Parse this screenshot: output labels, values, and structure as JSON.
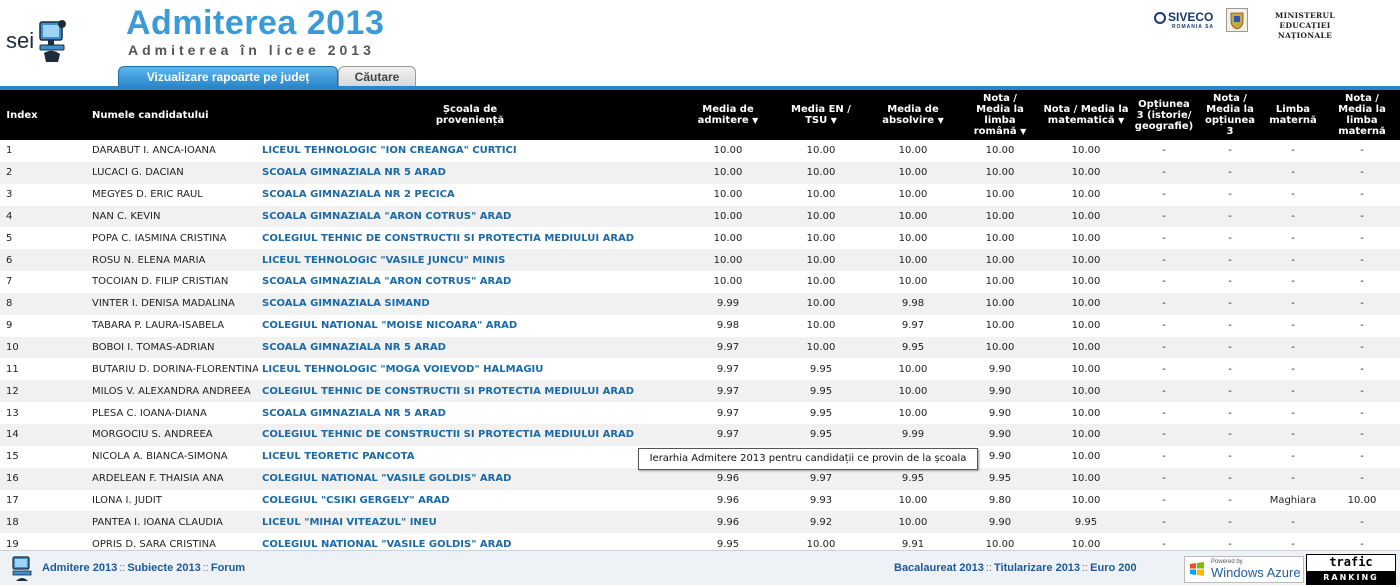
{
  "header": {
    "logo_text": "sei",
    "title": "Admiterea 2013",
    "subtitle": "Admiterea în licee 2013",
    "tabs": [
      {
        "label": "Vizualizare rapoarte pe județ",
        "active": true
      },
      {
        "label": "Căutare",
        "active": false
      }
    ],
    "partner_logo": "SIVECO",
    "partner_sub": "ROMANIA SA",
    "ministry": "MINISTERUL EDUCAȚIEI NAȚIONALE",
    "icons": [
      "computer-user-icon",
      "siveco-logo-icon",
      "ministry-crest-icon"
    ]
  },
  "table": {
    "headers": {
      "index": "Index",
      "name": "Numele candidatului",
      "school": "Școala de proveniență",
      "media_admitere": "Media de admitere",
      "media_en": "Media EN / TSU",
      "media_absolvire": "Media de absolvire",
      "nota_romana": "Nota / Media la limba română",
      "nota_mate": "Nota / Media la matematică",
      "optiunea": "Opțiunea 3 (istorie/ geografie)",
      "nota_optiunea": "Nota / Media la opțiunea 3",
      "limba_materna": "Limba maternă",
      "nota_materna": "Nota / Media la limba maternă"
    },
    "rows": [
      [
        "1",
        "DARABUT I. ANCA-IOANA",
        "LICEUL TEHNOLOGIC \"ION CREANGA\" CURTICI",
        "10.00",
        "10.00",
        "10.00",
        "10.00",
        "10.00",
        "-",
        "-",
        "-",
        "-"
      ],
      [
        "2",
        "LUCACI G. DACIAN",
        "SCOALA GIMNAZIALA NR 5 ARAD",
        "10.00",
        "10.00",
        "10.00",
        "10.00",
        "10.00",
        "-",
        "-",
        "-",
        "-"
      ],
      [
        "3",
        "MEGYES D. ERIC RAUL",
        "SCOALA GIMNAZIALA NR 2 PECICA",
        "10.00",
        "10.00",
        "10.00",
        "10.00",
        "10.00",
        "-",
        "-",
        "-",
        "-"
      ],
      [
        "4",
        "NAN C. KEVIN",
        "SCOALA GIMNAZIALA \"ARON COTRUS\" ARAD",
        "10.00",
        "10.00",
        "10.00",
        "10.00",
        "10.00",
        "-",
        "-",
        "-",
        "-"
      ],
      [
        "5",
        "POPA C. IASMINA CRISTINA",
        "COLEGIUL TEHNIC DE CONSTRUCTII SI PROTECTIA MEDIULUI ARAD",
        "10.00",
        "10.00",
        "10.00",
        "10.00",
        "10.00",
        "-",
        "-",
        "-",
        "-"
      ],
      [
        "6",
        "ROSU N. ELENA MARIA",
        "LICEUL TEHNOLOGIC \"VASILE JUNCU\" MINIS",
        "10.00",
        "10.00",
        "10.00",
        "10.00",
        "10.00",
        "-",
        "-",
        "-",
        "-"
      ],
      [
        "7",
        "TOCOIAN D. FILIP CRISTIAN",
        "SCOALA GIMNAZIALA \"ARON COTRUS\" ARAD",
        "10.00",
        "10.00",
        "10.00",
        "10.00",
        "10.00",
        "-",
        "-",
        "-",
        "-"
      ],
      [
        "8",
        "VINTER I. DENISA MADALINA",
        "SCOALA GIMNAZIALA SIMAND",
        "9.99",
        "10.00",
        "9.98",
        "10.00",
        "10.00",
        "-",
        "-",
        "-",
        "-"
      ],
      [
        "9",
        "TABARA P. LAURA-ISABELA",
        "COLEGIUL NATIONAL \"MOISE NICOARA\" ARAD",
        "9.98",
        "10.00",
        "9.97",
        "10.00",
        "10.00",
        "-",
        "-",
        "-",
        "-"
      ],
      [
        "10",
        "BOBOI I. TOMAS-ADRIAN",
        "SCOALA GIMNAZIALA NR 5 ARAD",
        "9.97",
        "10.00",
        "9.95",
        "10.00",
        "10.00",
        "-",
        "-",
        "-",
        "-"
      ],
      [
        "11",
        "BUTARIU D. DORINA-FLORENTINA",
        "LICEUL TEHNOLOGIC \"MOGA VOIEVOD\" HALMAGIU",
        "9.97",
        "9.95",
        "10.00",
        "9.90",
        "10.00",
        "-",
        "-",
        "-",
        "-"
      ],
      [
        "12",
        "MILOS V. ALEXANDRA ANDREEA",
        "COLEGIUL TEHNIC DE CONSTRUCTII SI PROTECTIA MEDIULUI ARAD",
        "9.97",
        "9.95",
        "10.00",
        "9.90",
        "10.00",
        "-",
        "-",
        "-",
        "-"
      ],
      [
        "13",
        "PLESA C. IOANA-DIANA",
        "SCOALA GIMNAZIALA NR 5 ARAD",
        "9.97",
        "9.95",
        "10.00",
        "9.90",
        "10.00",
        "-",
        "-",
        "-",
        "-"
      ],
      [
        "14",
        "MORGOCIU S. ANDREEA",
        "COLEGIUL TEHNIC DE CONSTRUCTII SI PROTECTIA MEDIULUI ARAD",
        "9.97",
        "9.95",
        "9.99",
        "9.90",
        "10.00",
        "-",
        "-",
        "-",
        "-"
      ],
      [
        "15",
        "NICOLA A. BIANCA-SIMONA",
        "LICEUL TEORETIC PANCOTA",
        "",
        "",
        "",
        "9.90",
        "10.00",
        "-",
        "-",
        "-",
        "-"
      ],
      [
        "16",
        "ARDELEAN F. THAISIA ANA",
        "COLEGIUL NATIONAL \"VASILE GOLDIS\" ARAD",
        "9.96",
        "9.97",
        "9.95",
        "9.95",
        "10.00",
        "-",
        "-",
        "-",
        "-"
      ],
      [
        "17",
        "ILONA I. JUDIT",
        "COLEGIUL \"CSIKI GERGELY\" ARAD",
        "9.96",
        "9.93",
        "10.00",
        "9.80",
        "10.00",
        "-",
        "-",
        "Maghiara",
        "10.00"
      ],
      [
        "18",
        "PANTEA I. IOANA CLAUDIA",
        "LICEUL \"MIHAI VITEAZUL\" INEU",
        "9.96",
        "9.92",
        "10.00",
        "9.90",
        "9.95",
        "-",
        "-",
        "-",
        "-"
      ],
      [
        "19",
        "OPRIS D. SARA CRISTINA",
        "COLEGIUL NATIONAL \"VASILE GOLDIS\" ARAD",
        "9.95",
        "10.00",
        "9.91",
        "10.00",
        "10.00",
        "-",
        "-",
        "-",
        "-"
      ]
    ]
  },
  "tooltip": "Ierarhia Admitere 2013 pentru candidații ce provin de la școala",
  "footer": {
    "left_links": [
      "Admitere 2013",
      "Subiecte 2013",
      "Forum"
    ],
    "right_links": [
      "Bacalaureat 2013",
      "Titularizare 2013",
      "Euro 200"
    ],
    "separator": "::",
    "azure_powered": "Powered by",
    "azure_brand": "Windows Azure",
    "trafic_top": "trafic",
    "trafic_bottom": "RANKING"
  }
}
